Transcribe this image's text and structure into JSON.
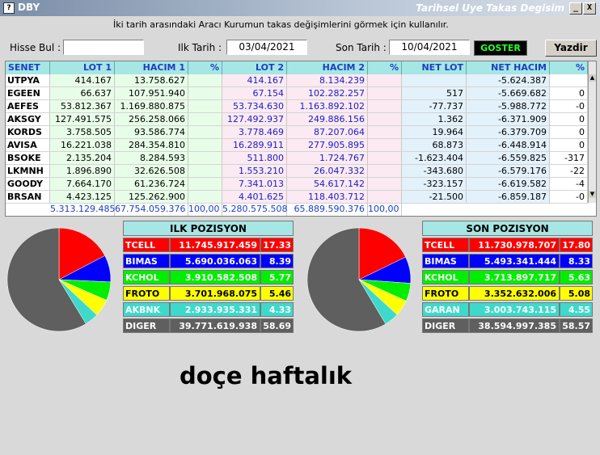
{
  "window": {
    "app_icon": "?",
    "title": "DBY",
    "title_right": "Tarihsel Uye Takas Degisim",
    "minimize": "_",
    "close": "X"
  },
  "instruction": "İki tarih arasındaki  Aracı Kurumun takas değişimlerini görmek için kullanılır.",
  "toolbar": {
    "search_label": "Hisse Bul :",
    "search_value": "",
    "start_label": "Ilk Tarih :",
    "start_value": "03/04/2021",
    "end_label": "Son Tarih :",
    "end_value": "10/04/2021",
    "show_button": "GOSTER",
    "print_button": "Yazdir"
  },
  "grid": {
    "headers": [
      "SENET",
      "LOT 1",
      "HACIM 1",
      "%",
      "LOT 2",
      "HACIM 2",
      "%",
      "NET LOT",
      "NET HACIM",
      "%"
    ],
    "rows": [
      {
        "senet": "UTPYA",
        "lot1": "414.167",
        "hacim1": "13.758.627",
        "lot2": "414.167",
        "hacim2": "8.134.239",
        "netlot": "",
        "nethacim": "-5.624.387",
        "pct": ""
      },
      {
        "senet": "EGEEN",
        "lot1": "66.637",
        "hacim1": "107.951.940",
        "lot2": "67.154",
        "hacim2": "102.282.257",
        "netlot": "517",
        "nethacim": "-5.669.682",
        "pct": "0"
      },
      {
        "senet": "AEFES",
        "lot1": "53.812.367",
        "hacim1": "1.169.880.875",
        "lot2": "53.734.630",
        "hacim2": "1.163.892.102",
        "netlot": "-77.737",
        "nethacim": "-5.988.772",
        "pct": "-0"
      },
      {
        "senet": "AKSGY",
        "lot1": "127.491.575",
        "hacim1": "256.258.066",
        "lot2": "127.492.937",
        "hacim2": "249.886.156",
        "netlot": "1.362",
        "nethacim": "-6.371.909",
        "pct": "0"
      },
      {
        "senet": "KORDS",
        "lot1": "3.758.505",
        "hacim1": "93.586.774",
        "lot2": "3.778.469",
        "hacim2": "87.207.064",
        "netlot": "19.964",
        "nethacim": "-6.379.709",
        "pct": "0"
      },
      {
        "senet": "AVISA",
        "lot1": "16.221.038",
        "hacim1": "284.354.810",
        "lot2": "16.289.911",
        "hacim2": "277.905.895",
        "netlot": "68.873",
        "nethacim": "-6.448.914",
        "pct": "0"
      },
      {
        "senet": "BSOKE",
        "lot1": "2.135.204",
        "hacim1": "8.284.593",
        "lot2": "511.800",
        "hacim2": "1.724.767",
        "netlot": "-1.623.404",
        "nethacim": "-6.559.825",
        "pct": "-317"
      },
      {
        "senet": "LKMNH",
        "lot1": "1.896.890",
        "hacim1": "32.626.508",
        "lot2": "1.553.210",
        "hacim2": "26.047.332",
        "netlot": "-343.680",
        "nethacim": "-6.579.176",
        "pct": "-22"
      },
      {
        "senet": "GOODY",
        "lot1": "7.664.170",
        "hacim1": "61.236.724",
        "lot2": "7.341.013",
        "hacim2": "54.617.142",
        "netlot": "-323.157",
        "nethacim": "-6.619.582",
        "pct": "-4"
      },
      {
        "senet": "BRSAN",
        "lot1": "4.423.125",
        "hacim1": "125.262.900",
        "lot2": "4.401.625",
        "hacim2": "118.403.712",
        "netlot": "-21.500",
        "nethacim": "-6.859.187",
        "pct": "-0"
      }
    ],
    "totals": {
      "lot1": "5.313.129.485",
      "hacim1": "67.754.059.376",
      "pct1": "100,00",
      "lot2": "5.280.575.508",
      "hacim2": "65.889.590.376",
      "pct2": "100,00"
    }
  },
  "ilk_pozisyon": {
    "title": "ILK POZISYON",
    "rows": [
      {
        "name": "TCELL",
        "value": "11.745.917.459",
        "pct": "17.33",
        "pct_num": 17.33,
        "bg": "#ff0000",
        "fg": "#ffffff"
      },
      {
        "name": "BIMAS",
        "value": "5.690.036.063",
        "pct": "8.39",
        "pct_num": 8.39,
        "bg": "#0000ff",
        "fg": "#ffffff"
      },
      {
        "name": "KCHOL",
        "value": "3.910.582.508",
        "pct": "5.77",
        "pct_num": 5.77,
        "bg": "#00ee00",
        "fg": "#ffffff"
      },
      {
        "name": "FROTO",
        "value": "3.701.968.075",
        "pct": "5.46",
        "pct_num": 5.46,
        "bg": "#ffff00",
        "fg": "#000000"
      },
      {
        "name": "AKBNK",
        "value": "2.933.935.331",
        "pct": "4.33",
        "pct_num": 4.33,
        "bg": "#3fd9cc",
        "fg": "#ffffff"
      },
      {
        "name": "DIGER",
        "value": "39.771.619.938",
        "pct": "58.69",
        "pct_num": 58.69,
        "bg": "#5f5f5f",
        "fg": "#ffffff"
      }
    ]
  },
  "son_pozisyon": {
    "title": "SON POZISYON",
    "rows": [
      {
        "name": "TCELL",
        "value": "11.730.978.707",
        "pct": "17.80",
        "pct_num": 17.8,
        "bg": "#ff0000",
        "fg": "#ffffff"
      },
      {
        "name": "BIMAS",
        "value": "5.493.341.444",
        "pct": "8.33",
        "pct_num": 8.33,
        "bg": "#0000ff",
        "fg": "#ffffff"
      },
      {
        "name": "KCHOL",
        "value": "3.713.897.717",
        "pct": "5.63",
        "pct_num": 5.63,
        "bg": "#00ee00",
        "fg": "#ffffff"
      },
      {
        "name": "FROTO",
        "value": "3.352.632.006",
        "pct": "5.08",
        "pct_num": 5.08,
        "bg": "#ffff00",
        "fg": "#000000"
      },
      {
        "name": "GARAN",
        "value": "3.003.743.115",
        "pct": "4.55",
        "pct_num": 4.55,
        "bg": "#3fd9cc",
        "fg": "#ffffff"
      },
      {
        "name": "DIGER",
        "value": "38.594.997.385",
        "pct": "58.57",
        "pct_num": 58.57,
        "bg": "#5f5f5f",
        "fg": "#ffffff"
      }
    ]
  },
  "caption": "doçe haftalık"
}
